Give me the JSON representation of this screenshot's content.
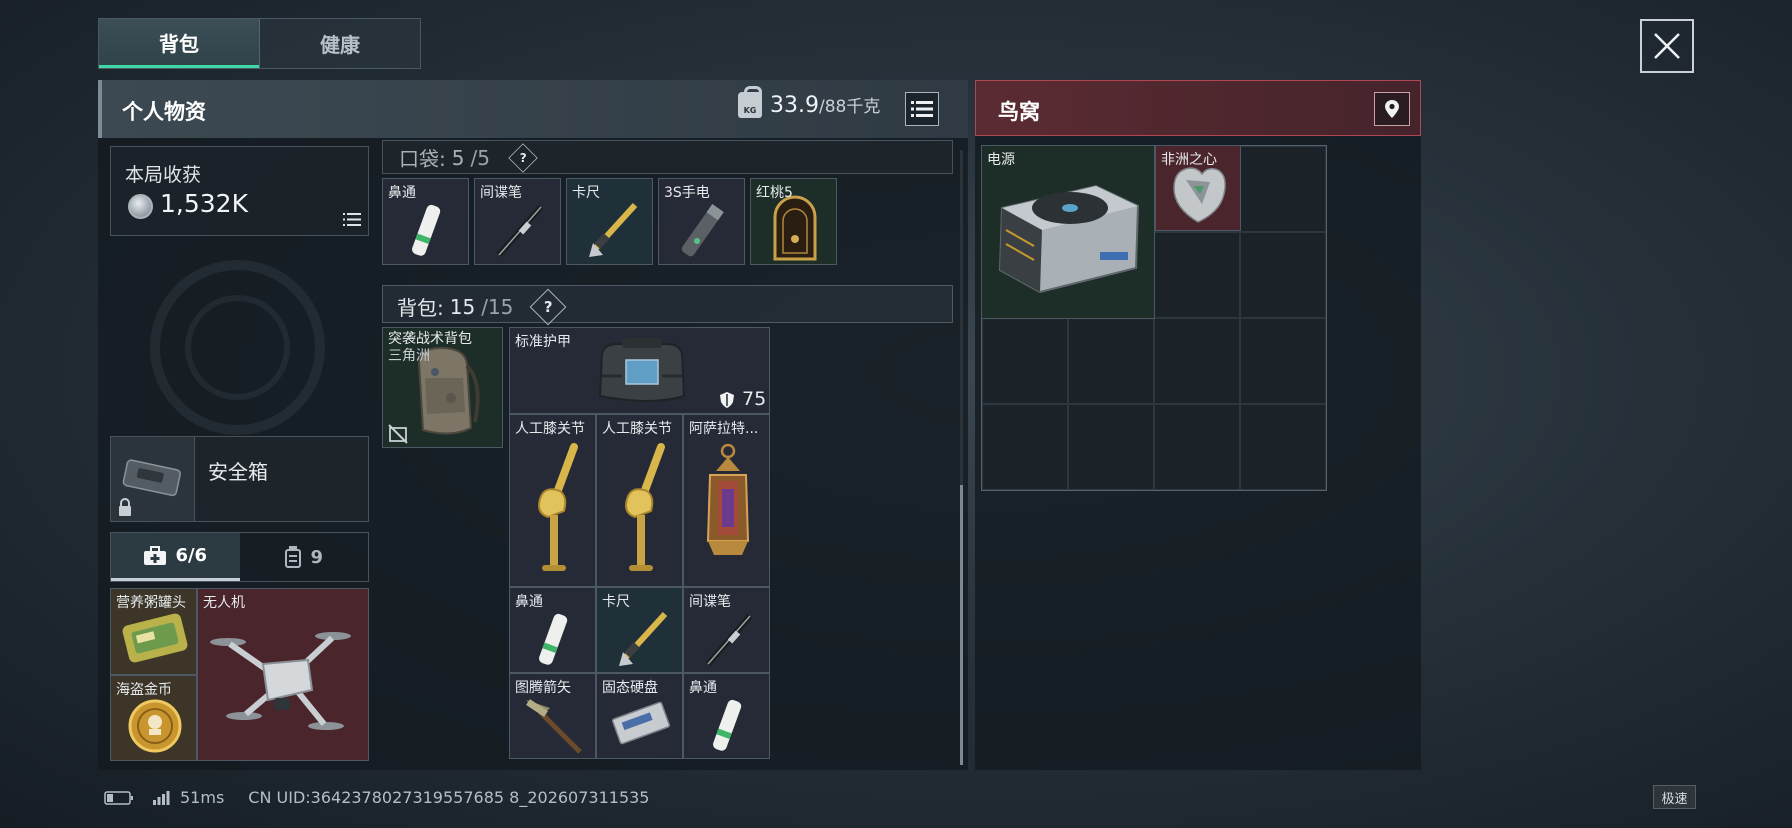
{
  "tabs": [
    {
      "label": "背包",
      "active": true
    },
    {
      "label": "健康",
      "active": false
    }
  ],
  "left_panel": {
    "title": "个人物资",
    "weight_current": "33.9",
    "weight_max": "/88千克",
    "weight_icon_text": "KG"
  },
  "right_panel": {
    "title": "鸟窝"
  },
  "harvest": {
    "label": "本局收获",
    "value": "1,532K"
  },
  "safebox": {
    "label": "安全箱"
  },
  "sub_tabs": [
    {
      "label": "6/6",
      "icon": "medkit-icon",
      "active": true
    },
    {
      "label": "9",
      "icon": "canister-icon",
      "active": false
    }
  ],
  "secure_items": [
    {
      "name": "营养粥罐头"
    },
    {
      "name": "无人机"
    },
    {
      "name": "海盗金币"
    }
  ],
  "pocket": {
    "label": "口袋:",
    "current": "5",
    "max": "/5",
    "help": "?"
  },
  "pocket_items": [
    {
      "name": "鼻通"
    },
    {
      "name": "间谍笔"
    },
    {
      "name": "卡尺"
    },
    {
      "name": "3S手电"
    },
    {
      "name": "红桃5"
    }
  ],
  "backpack": {
    "label": "背包:",
    "current": "15",
    "max": "/15",
    "help": "?",
    "equipped_name_line1": "突袭战术背包",
    "equipped_name_line2": "三角洲"
  },
  "backpack_items": {
    "armor": {
      "name": "标准护甲",
      "durability": "75"
    },
    "knee1": {
      "name": "人工膝关节"
    },
    "knee2": {
      "name": "人工膝关节"
    },
    "lantern": {
      "name": "阿萨拉特..."
    },
    "nose1": {
      "name": "鼻通"
    },
    "caliper": {
      "name": "卡尺"
    },
    "spypen": {
      "name": "间谍笔"
    },
    "arrow": {
      "name": "图腾箭矢"
    },
    "ssd": {
      "name": "固态硬盘"
    },
    "nose2": {
      "name": "鼻通"
    }
  },
  "stash_items": [
    {
      "name": "电源"
    },
    {
      "name": "非洲之心"
    }
  ],
  "footer": {
    "ping": "51ms",
    "uid": "CN UID:3642378027319557685 8_202607311535",
    "speed": "极速"
  }
}
